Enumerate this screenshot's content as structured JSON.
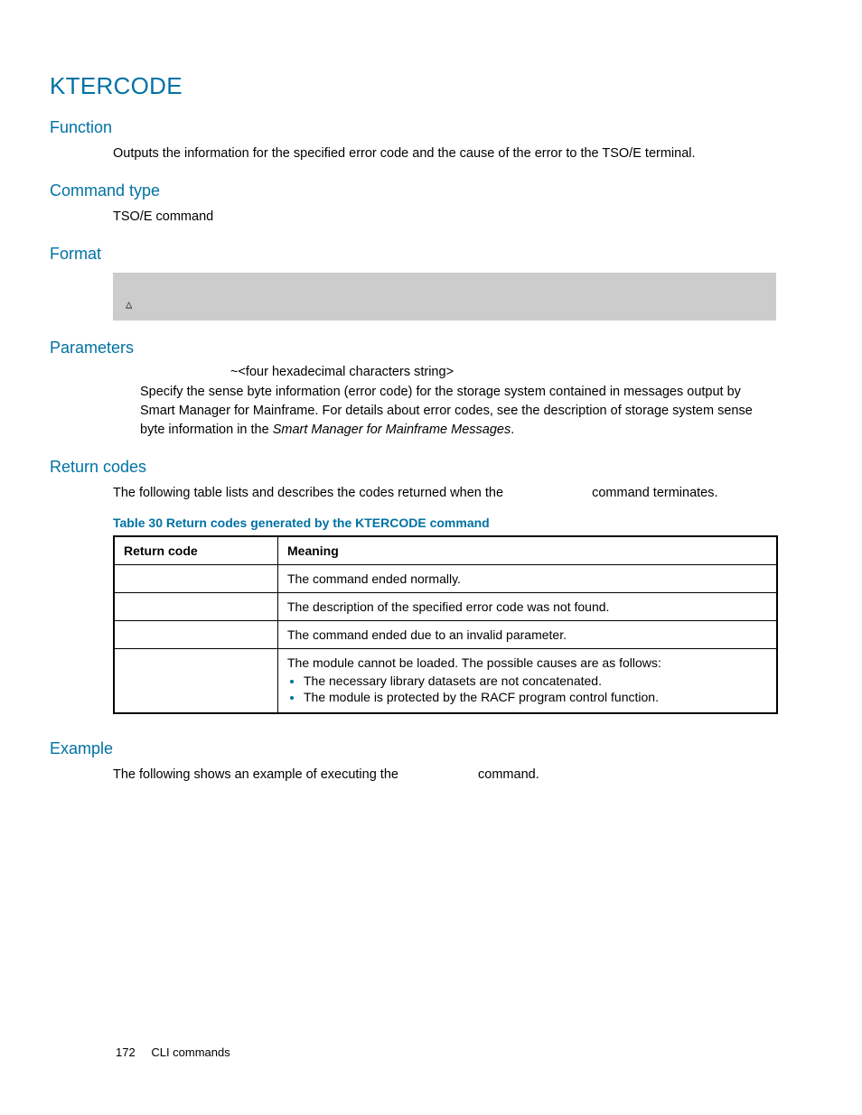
{
  "title": "KTERCODE",
  "sections": {
    "function": {
      "heading": "Function",
      "text": "Outputs the information for the specified error code and the cause of the error to the TSO/E terminal."
    },
    "command_type": {
      "heading": "Command type",
      "text": "TSO/E command"
    },
    "format": {
      "heading": "Format",
      "code_symbol": "△"
    },
    "parameters": {
      "heading": "Parameters",
      "param_format": "~<four hexadecimal characters string>",
      "para_pt1": "Specify the sense byte information (error code) for the storage system contained in messages output by Smart Manager for Mainframe. For details about error codes, see the description of storage system sense byte information in the ",
      "para_italic": "Smart Manager for Mainframe Messages",
      "para_pt2": "."
    },
    "return_codes": {
      "heading": "Return codes",
      "intro_pt1": "The following table lists and describes the codes returned when the ",
      "intro_pt2": " command terminates.",
      "table_caption": "Table 30 Return codes generated by the KTERCODE command",
      "table": {
        "headers": {
          "col1": "Return code",
          "col2": "Meaning"
        },
        "rows": [
          {
            "code": "",
            "meaning": "The command ended normally."
          },
          {
            "code": "",
            "meaning": "The description of the specified error code was not found."
          },
          {
            "code": "",
            "meaning": "The command ended due to an invalid parameter."
          },
          {
            "code": "",
            "meaning": "The module cannot be loaded. The possible causes are as follows:",
            "causes": [
              "The necessary library datasets are not concatenated.",
              "The module is protected by the RACF program control function."
            ]
          }
        ]
      }
    },
    "example": {
      "heading": "Example",
      "text_pt1": "The following shows an example of executing the ",
      "text_pt2": " command."
    }
  },
  "footer": {
    "page_number": "172",
    "section": "CLI commands"
  }
}
